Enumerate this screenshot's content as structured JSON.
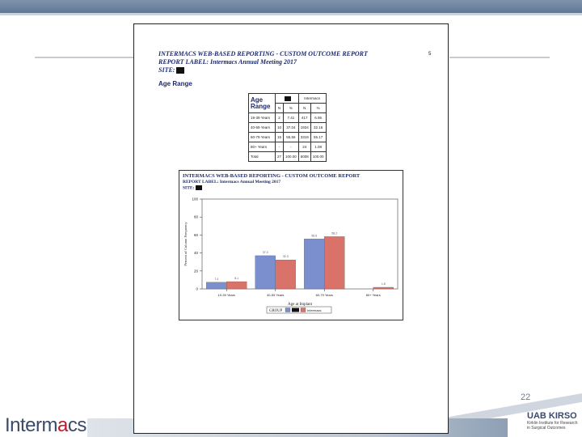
{
  "slide": {
    "number": "22"
  },
  "logo": {
    "pre": "Interm",
    "a": "a",
    "post": "cs"
  },
  "uab": {
    "title_left": "UAB",
    "title_right": "KIRSO",
    "sub1": "Kirklin Institute for Research",
    "sub2": "in Surgical Outcomes"
  },
  "document": {
    "header1": "INTERMACS WEB-BASED REPORTING - CUSTOM OUTCOME REPORT",
    "header2": "REPORT LABEL: Intermacs Annual Meeting 2017",
    "site_label": "SITE:",
    "page_number": "5",
    "section_title": "Age Range",
    "table": {
      "title_line1": "Age",
      "title_line2": "Range",
      "group2": "Intermacs",
      "col_n": "N",
      "col_pct": "%",
      "rows": [
        {
          "label": "19-39 Years",
          "n1": "2",
          "p1": "7.41",
          "n2": "417",
          "p2": "6.95"
        },
        {
          "label": "40-59 Years",
          "n1": "10",
          "p1": "37.04",
          "n2": "1934",
          "p2": "32.16"
        },
        {
          "label": "60-79 Years",
          "n1": "15",
          "p1": "55.56",
          "n2": "3319",
          "p2": "55.17"
        },
        {
          "label": "80+ Years",
          "n1": "-",
          "p1": "-",
          "n2": "24",
          "p2": "1.08"
        },
        {
          "label": "Total",
          "n1": "27",
          "p1": "100.00",
          "n2": "6008",
          "p2": "100.00"
        }
      ]
    }
  },
  "figure": {
    "header1": "INTERMACS WEB-BASED REPORTING - CUSTOM OUTCOME REPORT",
    "header2": "REPORT LABEL: Intermacs Annual Meeting 2017",
    "site_label": "SITE:"
  },
  "chart_data": {
    "type": "bar",
    "categories": [
      "19-39 Years",
      "40-59 Years",
      "60-79 Years",
      "80+ Years"
    ],
    "series": [
      {
        "values": [
          7.4,
          37.0,
          55.6,
          0
        ],
        "color": "#7b8fcf"
      },
      {
        "name": "Intermacs",
        "values": [
          8.1,
          32.3,
          58.2,
          1.8
        ],
        "color": "#d9736a"
      }
    ],
    "data_labels": [
      [
        "7.4",
        "37.0",
        "55.6",
        ""
      ],
      [
        "8.1",
        "32.3",
        "58.2",
        "1.8"
      ]
    ],
    "yticks": [
      "0",
      "20",
      "40",
      "60",
      "80",
      "100"
    ],
    "ylim": [
      0,
      100
    ],
    "ylabel": "Percent of Column Frequency",
    "xlabel": "Age at Implant",
    "legend_label": "GROUP"
  }
}
